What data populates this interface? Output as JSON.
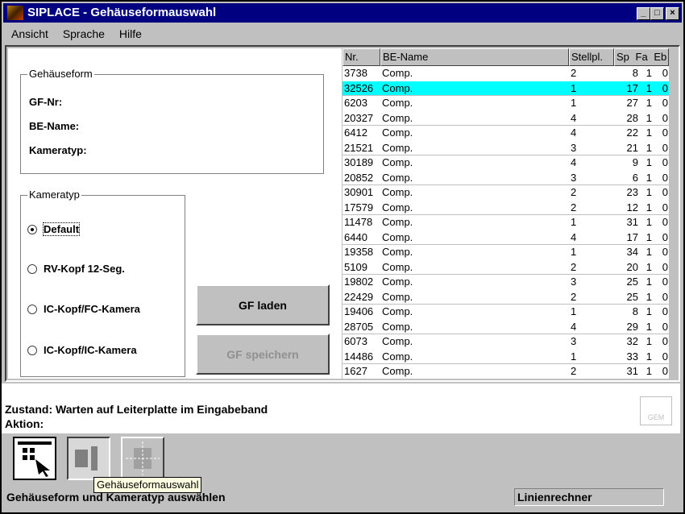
{
  "window": {
    "title": "SIPLACE - Gehäuseformauswahl",
    "buttons": [
      "_",
      "□",
      "×"
    ]
  },
  "menu": [
    "Ansicht",
    "Sprache",
    "Hilfe"
  ],
  "gehaeuseform": {
    "legend": "Gehäuseform",
    "fields": [
      "GF-Nr:",
      "BE-Name:",
      "Kameratyp:"
    ]
  },
  "kameratyp": {
    "legend": "Kameratyp",
    "options": [
      {
        "label": "Default",
        "checked": true
      },
      {
        "label": "RV-Kopf 12-Seg.",
        "checked": false
      },
      {
        "label": "IC-Kopf/FC-Kamera",
        "checked": false
      },
      {
        "label": "IC-Kopf/IC-Kamera",
        "checked": false
      }
    ]
  },
  "buttons": {
    "load": "GF laden",
    "save": "GF speichern"
  },
  "table": {
    "headers": [
      "Nr.",
      "BE-Name",
      "Stellpl.",
      "Sp",
      "Fa",
      "Eb"
    ],
    "selected_index": 1,
    "selection_color": "#00ffff",
    "rows": [
      [
        "3738",
        "Comp.",
        "2",
        "8",
        "1",
        "0"
      ],
      [
        "32526",
        "Comp.",
        "1",
        "17",
        "1",
        "0"
      ],
      [
        "6203",
        "Comp.",
        "1",
        "27",
        "1",
        "0"
      ],
      [
        "20327",
        "Comp.",
        "4",
        "28",
        "1",
        "0"
      ],
      [
        "6412",
        "Comp.",
        "4",
        "22",
        "1",
        "0"
      ],
      [
        "21521",
        "Comp.",
        "3",
        "21",
        "1",
        "0"
      ],
      [
        "30189",
        "Comp.",
        "4",
        "9",
        "1",
        "0"
      ],
      [
        "20852",
        "Comp.",
        "3",
        "6",
        "1",
        "0"
      ],
      [
        "30901",
        "Comp.",
        "2",
        "23",
        "1",
        "0"
      ],
      [
        "17579",
        "Comp.",
        "2",
        "12",
        "1",
        "0"
      ],
      [
        "11478",
        "Comp.",
        "1",
        "31",
        "1",
        "0"
      ],
      [
        "6440",
        "Comp.",
        "4",
        "17",
        "1",
        "0"
      ],
      [
        "19358",
        "Comp.",
        "1",
        "34",
        "1",
        "0"
      ],
      [
        "5109",
        "Comp.",
        "2",
        "20",
        "1",
        "0"
      ],
      [
        "19802",
        "Comp.",
        "3",
        "25",
        "1",
        "0"
      ],
      [
        "22429",
        "Comp.",
        "2",
        "25",
        "1",
        "0"
      ],
      [
        "19406",
        "Comp.",
        "1",
        "8",
        "1",
        "0"
      ],
      [
        "28705",
        "Comp.",
        "4",
        "29",
        "1",
        "0"
      ],
      [
        "6073",
        "Comp.",
        "3",
        "32",
        "1",
        "0"
      ],
      [
        "14486",
        "Comp.",
        "1",
        "33",
        "1",
        "0"
      ],
      [
        "1627",
        "Comp.",
        "2",
        "31",
        "1",
        "0"
      ]
    ]
  },
  "status": {
    "zustand": "Zustand: Warten auf Leiterplatte im Eingabeband",
    "aktion": "Aktion:",
    "gem": "GEM"
  },
  "tooltip": "Gehäuseformauswahl",
  "statusbar": {
    "text": "Gehäuseform und Kameratyp auswählen",
    "panel": "Linienrechner"
  }
}
